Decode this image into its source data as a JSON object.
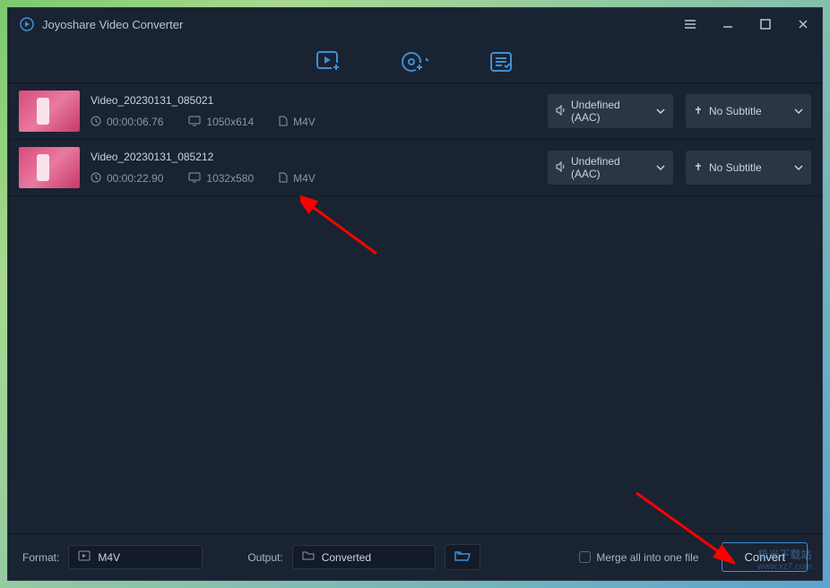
{
  "app": {
    "title": "Joyoshare Video Converter"
  },
  "files": [
    {
      "name": "Video_20230131_085021",
      "duration": "00:00:06.76",
      "resolution": "1050x614",
      "format": "M4V",
      "audio": "Undefined (AAC)",
      "subtitle": "No Subtitle"
    },
    {
      "name": "Video_20230131_085212",
      "duration": "00:00:22.90",
      "resolution": "1032x580",
      "format": "M4V",
      "audio": "Undefined (AAC)",
      "subtitle": "No Subtitle"
    }
  ],
  "bottom": {
    "format_label": "Format:",
    "format_value": "M4V",
    "output_label": "Output:",
    "output_value": "Converted",
    "merge_label": "Merge all into one file",
    "convert_label": "Convert"
  },
  "watermark": {
    "line1": "极光下载站",
    "line2": "www.xz7.com"
  }
}
